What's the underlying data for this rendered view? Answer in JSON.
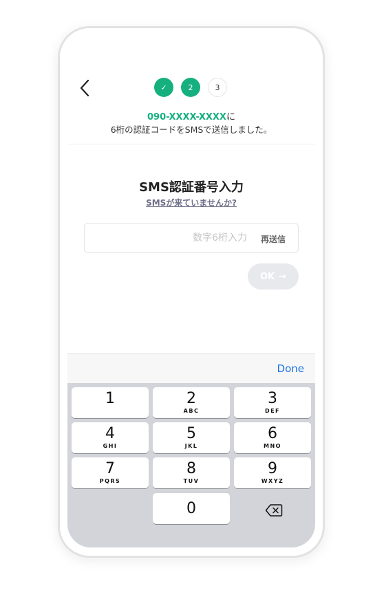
{
  "header": {
    "steps": [
      {
        "label": "✓",
        "state": "done"
      },
      {
        "label": "2",
        "state": "current"
      },
      {
        "label": "3",
        "state": "todo"
      }
    ],
    "phone_number": "090-XXXX-XXXX",
    "phone_suffix": "に",
    "sent_message": "6桁の認証コードをSMSで送信しました。"
  },
  "main": {
    "title": "SMS認証番号入力",
    "help_link": "SMSが来ていませんか?",
    "code_input": {
      "value": "",
      "placeholder": "数字6桁入力"
    },
    "resend_label": "再送信",
    "ok_label": "OK",
    "ok_arrow": "→"
  },
  "keyboard": {
    "done_label": "Done",
    "keys": [
      {
        "num": "1",
        "letters": ""
      },
      {
        "num": "2",
        "letters": "ABC"
      },
      {
        "num": "3",
        "letters": "DEF"
      },
      {
        "num": "4",
        "letters": "GHI"
      },
      {
        "num": "5",
        "letters": "JKL"
      },
      {
        "num": "6",
        "letters": "MNO"
      },
      {
        "num": "7",
        "letters": "PQRS"
      },
      {
        "num": "8",
        "letters": "TUV"
      },
      {
        "num": "9",
        "letters": "WXYZ"
      },
      {
        "num": "0",
        "letters": ""
      }
    ]
  },
  "colors": {
    "accent": "#16b07f",
    "link": "#1a73e8",
    "keyboard_bg": "#d2d4d9"
  }
}
